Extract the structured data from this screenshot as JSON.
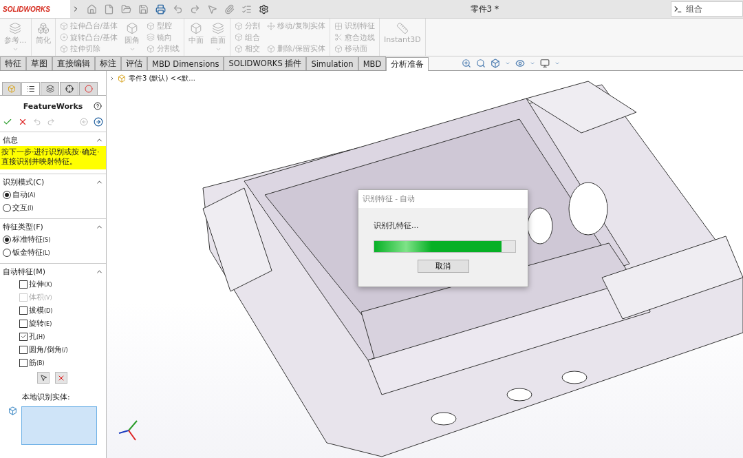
{
  "app": {
    "logo": "SOLIDWORKS",
    "title": "零件3 *",
    "search": {
      "value": "组合"
    }
  },
  "ribbon": {
    "groups": [
      {
        "columns": [
          {
            "items": [
              {
                "kind": "large",
                "label": "参考...",
                "disabled": true,
                "dropdown": true
              }
            ]
          }
        ]
      },
      {
        "columns": [
          {
            "items": [
              {
                "kind": "large",
                "label": "简化",
                "disabled": true,
                "dropdown": false
              }
            ]
          }
        ]
      },
      {
        "columns": [
          {
            "items": [
              {
                "kind": "small",
                "label": "拉伸凸台/基体",
                "disabled": true
              },
              {
                "kind": "small",
                "label": "旋转凸台/基体",
                "disabled": true
              },
              {
                "kind": "small",
                "label": "拉伸切除",
                "disabled": true
              }
            ]
          },
          {
            "items": [
              {
                "kind": "large",
                "label": "圆角",
                "disabled": true,
                "dropdown": true
              }
            ]
          },
          {
            "items": [
              {
                "kind": "small",
                "label": "型腔",
                "disabled": true
              },
              {
                "kind": "small",
                "label": "镜向",
                "disabled": true
              },
              {
                "kind": "small",
                "label": "分割线",
                "disabled": true
              }
            ]
          }
        ]
      },
      {
        "columns": [
          {
            "items": [
              {
                "kind": "large",
                "label": "中面",
                "disabled": true,
                "dropdown": false
              }
            ]
          },
          {
            "items": [
              {
                "kind": "large",
                "label": "曲面",
                "disabled": true,
                "dropdown": true
              }
            ]
          }
        ]
      },
      {
        "columns": [
          {
            "items": [
              {
                "kind": "small",
                "label": "分割",
                "disabled": true
              },
              {
                "kind": "small",
                "label": "组合",
                "disabled": true
              },
              {
                "kind": "small",
                "label": "相交",
                "disabled": true
              }
            ]
          },
          {
            "items": [
              {
                "kind": "small",
                "label": "移动/复制实体",
                "disabled": true
              },
              {
                "kind": "small",
                "label": "删除/保留实体",
                "disabled": true
              }
            ]
          }
        ]
      },
      {
        "columns": [
          {
            "items": [
              {
                "kind": "small",
                "label": "识别特征",
                "disabled": true
              },
              {
                "kind": "small",
                "label": "愈合边线",
                "disabled": true
              },
              {
                "kind": "small",
                "label": "移动面",
                "disabled": true
              }
            ]
          }
        ]
      },
      {
        "columns": [
          {
            "items": [
              {
                "kind": "large",
                "label": "Instant3D",
                "disabled": true,
                "dropdown": false
              }
            ]
          }
        ]
      }
    ]
  },
  "tabs": [
    {
      "label": "特征",
      "selected": false
    },
    {
      "label": "草图",
      "selected": false
    },
    {
      "label": "直接编辑",
      "selected": false
    },
    {
      "label": "标注",
      "selected": false
    },
    {
      "label": "评估",
      "selected": false
    },
    {
      "label": "MBD Dimensions",
      "selected": false
    },
    {
      "label": "SOLIDWORKS 插件",
      "selected": false
    },
    {
      "label": "Simulation",
      "selected": false
    },
    {
      "label": "MBD",
      "selected": false
    },
    {
      "label": "分析准备",
      "selected": true
    }
  ],
  "tree": {
    "label": "零件3 (默认) <<默..."
  },
  "panel": {
    "tabs": [
      {
        "selected": false
      },
      {
        "selected": true
      },
      {
        "selected": false
      },
      {
        "selected": false
      },
      {
        "selected": false
      }
    ],
    "title": "FeatureWorks",
    "info": {
      "title": "信息",
      "expanded": true,
      "message": "按下一步·进行识别或按·确定·直接识别并映射特征。"
    },
    "mode": {
      "title": "识别模式(C)",
      "expanded": true,
      "options": [
        {
          "label": "自动",
          "hotkey": "(A)",
          "selected": true
        },
        {
          "label": "交互",
          "hotkey": "(I)",
          "selected": false
        }
      ]
    },
    "type": {
      "title": "特征类型(F)",
      "expanded": true,
      "options": [
        {
          "label": "标准特征",
          "hotkey": "(S)",
          "selected": true
        },
        {
          "label": "钣金特征",
          "hotkey": "(L)",
          "selected": false
        }
      ]
    },
    "auto": {
      "title": "自动特征(M)",
      "expanded": true,
      "options": [
        {
          "label": "拉伸",
          "hotkey": "(X)",
          "checked": false,
          "disabled": false
        },
        {
          "label": "体积",
          "hotkey": "(V)",
          "checked": false,
          "disabled": true
        },
        {
          "label": "拔模",
          "hotkey": "(D)",
          "checked": false,
          "disabled": false
        },
        {
          "label": "旋转",
          "hotkey": "(E)",
          "checked": false,
          "disabled": false
        },
        {
          "label": "孔",
          "hotkey": "(H)",
          "checked": true,
          "disabled": false
        },
        {
          "label": "圆角/倒角",
          "hotkey": "(/)",
          "checked": false,
          "disabled": false
        },
        {
          "label": "筋",
          "hotkey": "(B)",
          "checked": false,
          "disabled": false
        }
      ]
    },
    "local_label": "本地识别实体:"
  },
  "dialog": {
    "title": "识别特征 - 自动",
    "message": "识别孔特征...",
    "level": 0.9,
    "button": "取消"
  }
}
